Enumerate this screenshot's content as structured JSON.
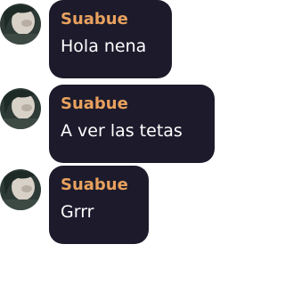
{
  "messages": [
    {
      "author": "Suabue",
      "text": "Hola nena",
      "avatar_icon": "user-avatar-photo"
    },
    {
      "author": "Suabue",
      "text": "A ver las tetas",
      "avatar_icon": "user-avatar-photo"
    },
    {
      "author": "Suabue",
      "text": "Grrr",
      "avatar_icon": "user-avatar-photo"
    }
  ],
  "colors": {
    "bubble": "#1c1a2b",
    "author": "#e8a15e",
    "text": "#ffffff"
  }
}
